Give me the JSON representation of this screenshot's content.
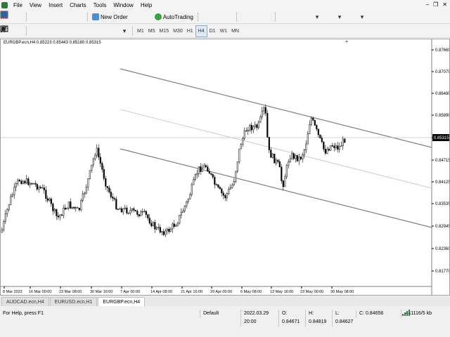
{
  "menu": [
    "File",
    "View",
    "Insert",
    "Charts",
    "Tools",
    "Window",
    "Help"
  ],
  "window_controls": [
    "–",
    "❐",
    "✕"
  ],
  "toolbar": {
    "new_order": "New Order",
    "autotrading": "AutoTrading",
    "timeframes": [
      "M1",
      "M5",
      "M15",
      "M30",
      "H1",
      "H4",
      "D1",
      "W1",
      "MN"
    ]
  },
  "chart": {
    "header": "EURGBP.ecn,H4  0.85223 0.85443 0.85180 0.85315",
    "current_price": "0.85315",
    "price_labels": [
      "0.87660",
      "0.87070",
      "0.86480",
      "0.85890",
      "0.85315",
      "0.84715",
      "0.84125",
      "0.83535",
      "0.82945",
      "0.82360",
      "0.81770",
      "0.81180"
    ],
    "time_labels": [
      "8 Mar 2022",
      "16 Mar 00:00",
      "23 Mar 08:00",
      "30 Mar 16:00",
      "7 Apr 00:00",
      "14 Apr 08:00",
      "21 Apr 16:00",
      "29 Apr 00:00",
      "6 May 08:00",
      "13 May 16:00",
      "23 May 00:00",
      "30 May 08:00"
    ]
  },
  "tabs": [
    "AUDCAD.ecn,H4",
    "EURUSD.ecn,H1",
    "EURGBP.ecn,H4"
  ],
  "active_tab": 2,
  "status": {
    "help": "For Help, press F1",
    "profile": "Default",
    "datetime": "2022.03.29 20:00",
    "open": "O: 0.84671",
    "high": "H: 0.84819",
    "low": "L: 0.84627",
    "close": "C: 0.84656",
    "traffic": "411116/5 kb"
  },
  "colors": {
    "candle": "#000000",
    "channel": "#808080",
    "channel_mid": "#c0c0c0",
    "bid_line": "#c0c0c0"
  }
}
